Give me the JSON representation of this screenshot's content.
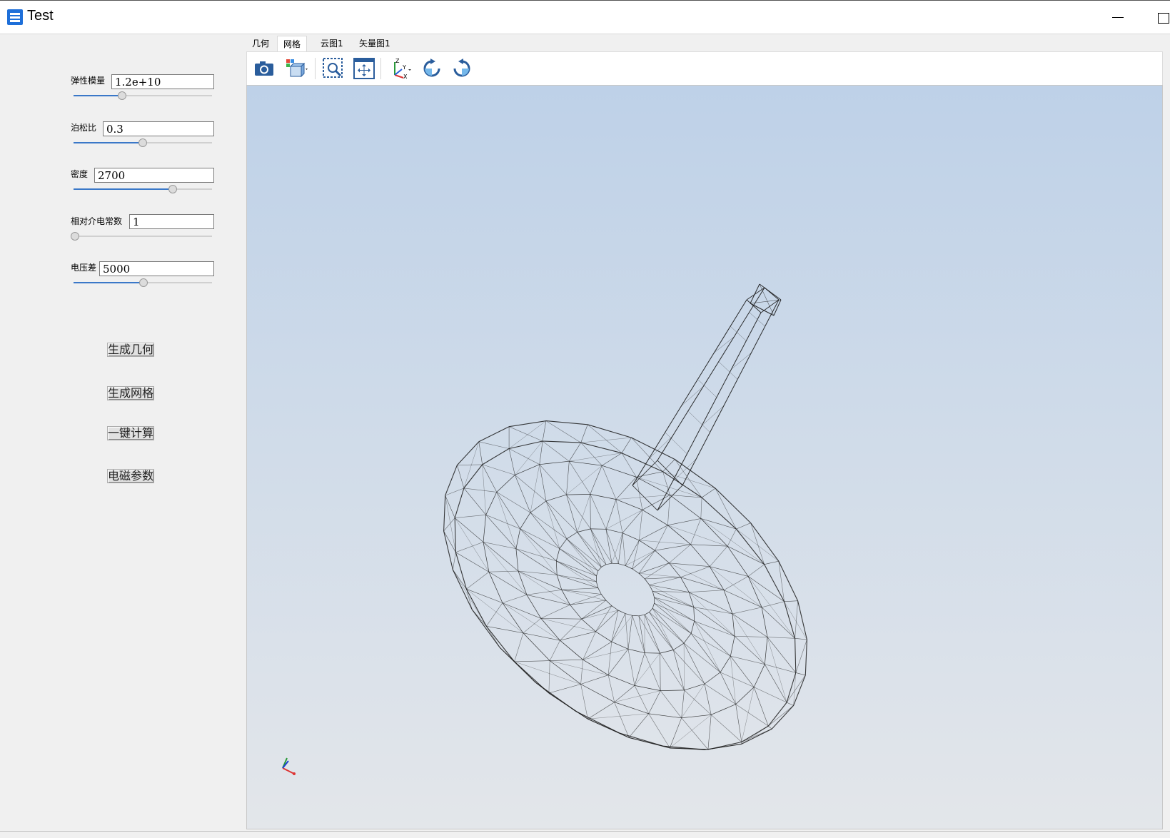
{
  "window": {
    "title": "Test"
  },
  "params": [
    {
      "label": "弹性模量",
      "value": "1.2e+10",
      "slider": 0.35
    },
    {
      "label": "泊松比",
      "value": "0.3",
      "slider": 0.5
    },
    {
      "label": "密度",
      "value": "2700",
      "slider": 0.72
    },
    {
      "label": "相对介电常数",
      "value": "1",
      "slider": 0.0
    },
    {
      "label": "电压差",
      "value": "5000",
      "slider": 0.5
    }
  ],
  "actions": {
    "generate_geometry": "生成几何",
    "generate_mesh": "生成网格",
    "one_click_compute": "一键计算",
    "em_params": "电磁参数"
  },
  "tabs": [
    "几何",
    "网格",
    "云图1",
    "矢量图1"
  ],
  "active_tab": "网格",
  "toolbar_icons": [
    "camera-icon",
    "display-mode-icon",
    "zoom-box-icon",
    "fit-view-icon",
    "view-axes-icon",
    "rotate-cw-icon",
    "rotate-ccw-icon"
  ],
  "colors": {
    "slider_fill": "#3a78c8",
    "viewport_top": "#bed1e8",
    "viewport_bottom": "#e3e6ea",
    "mesh_line": "#1a1a1a"
  }
}
